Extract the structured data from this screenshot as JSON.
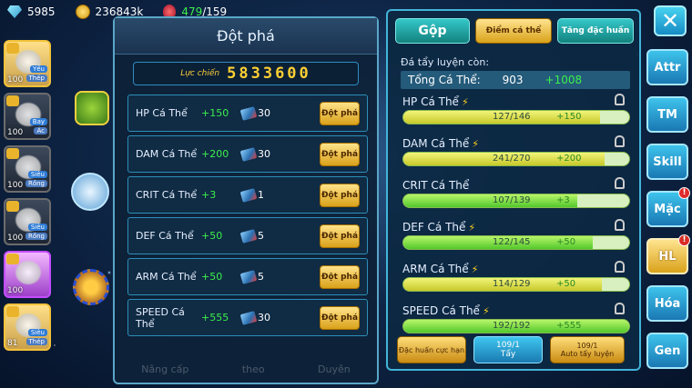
{
  "top": {
    "gems": "5985",
    "coins": "236843k",
    "potions_current": "479",
    "potions_max": "/159"
  },
  "slots": [
    {
      "level": "100",
      "tag": "Yếu",
      "tag2": "Thép",
      "style": "gold"
    },
    {
      "level": "100",
      "tag": "Bay",
      "tag2": "Ác",
      "style": "gray"
    },
    {
      "level": "100",
      "tag": "Siêu",
      "tag2": "Rồng",
      "style": "gray"
    },
    {
      "level": "100",
      "tag": "Siêu",
      "tag2": "Rồng",
      "style": "gray"
    },
    {
      "level": "100",
      "tag": "",
      "tag2": "",
      "style": "purple"
    },
    {
      "level": "81",
      "tag": "Siêu",
      "tag2": "Thép",
      "style": "gold"
    }
  ],
  "breakthrough": {
    "title": "Đột phá",
    "power_label": "Lực chiến",
    "power_value": "5833600",
    "rows": [
      {
        "name": "HP Cá Thể",
        "bonus": "+150",
        "cost": "30",
        "button": "Đột phá"
      },
      {
        "name": "DAM Cá Thể",
        "bonus": "+200",
        "cost": "30",
        "button": "Đột phá"
      },
      {
        "name": "CRIT Cá Thể",
        "bonus": "+3",
        "cost": "1",
        "button": "Đột phá"
      },
      {
        "name": "DEF Cá Thể",
        "bonus": "+50",
        "cost": "5",
        "button": "Đột phá"
      },
      {
        "name": "ARM Cá Thể",
        "bonus": "+50",
        "cost": "5",
        "button": "Đột phá"
      },
      {
        "name": "SPEED Cá Thể",
        "bonus": "+555",
        "cost": "30",
        "button": "Đột phá"
      }
    ],
    "bottom": [
      "Nâng cấp",
      "theo",
      "Duyên"
    ]
  },
  "training": {
    "tabs": {
      "merge": "Gộp",
      "points": "Điểm cá thể",
      "special": "Tăng đặc huấn"
    },
    "section_label": "Đá tẩy luyện còn:",
    "total_label": "Tổng Cá Thể:",
    "total_value": "903",
    "total_bonus": "+1008",
    "stats": [
      {
        "name": "HP Cá Thể",
        "current": 127,
        "max": 146,
        "text": "127/146",
        "add": "+150",
        "color": "yellow",
        "bolt": true
      },
      {
        "name": "DAM Cá Thể",
        "current": 241,
        "max": 270,
        "text": "241/270",
        "add": "+200",
        "color": "yellow",
        "bolt": true
      },
      {
        "name": "CRIT Cá Thể",
        "current": 107,
        "max": 139,
        "text": "107/139",
        "add": "+3",
        "color": "green",
        "bolt": false
      },
      {
        "name": "DEF Cá Thể",
        "current": 122,
        "max": 145,
        "text": "122/145",
        "add": "+50",
        "color": "green",
        "bolt": true
      },
      {
        "name": "ARM Cá Thể",
        "current": 114,
        "max": 129,
        "text": "114/129",
        "add": "+50",
        "color": "yellow",
        "bolt": true
      },
      {
        "name": "SPEED Cá Thể",
        "current": 192,
        "max": 192,
        "text": "192/192",
        "add": "+555",
        "color": "green",
        "bolt": true
      }
    ],
    "buttons": {
      "limit": "Đặc huấn cực hạn",
      "wash_count": "109/1",
      "wash_label": "Tẩy",
      "auto_count": "109/1",
      "auto_label": "Auto tẩy luyện"
    }
  },
  "side_nav": [
    "Attr",
    "TM",
    "Skill",
    "Mặc",
    "HL",
    "Hóa",
    "Gen"
  ],
  "side_badges": [
    "Mặc",
    "HL"
  ],
  "side_active": "HL",
  "close_glyph": "✕",
  "colors": {
    "accent": "#43b4d8",
    "gold": "#d9a21b",
    "bonus_green": "#3cf04c"
  }
}
